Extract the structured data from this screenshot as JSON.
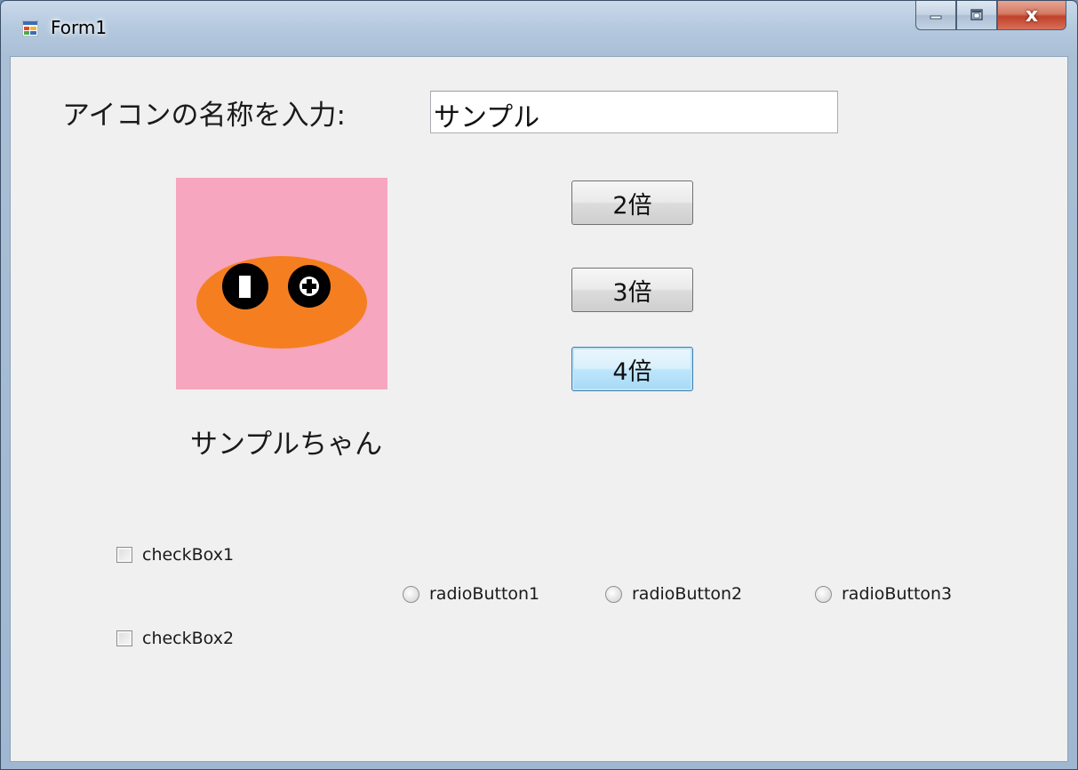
{
  "window": {
    "title": "Form1",
    "close_glyph": "x",
    "icons": [
      "app-form-icon",
      "minimize-icon",
      "maximize-icon",
      "close-icon"
    ]
  },
  "form": {
    "name_label": "アイコンの名称を入力:",
    "name_input_value": "サンプル",
    "picture_caption": "サンプルちゃん",
    "buttons": {
      "x2": "2倍",
      "x3": "3倍",
      "x4": "4倍"
    },
    "checkboxes": [
      {
        "label": "checkBox1",
        "checked": false
      },
      {
        "label": "checkBox2",
        "checked": false
      }
    ],
    "radios": [
      {
        "label": "radioButton1",
        "selected": false
      },
      {
        "label": "radioButton2",
        "selected": false
      },
      {
        "label": "radioButton3",
        "selected": false
      }
    ]
  },
  "colors": {
    "picture_background": "#f7a6bf",
    "blob": "#f57f20"
  }
}
